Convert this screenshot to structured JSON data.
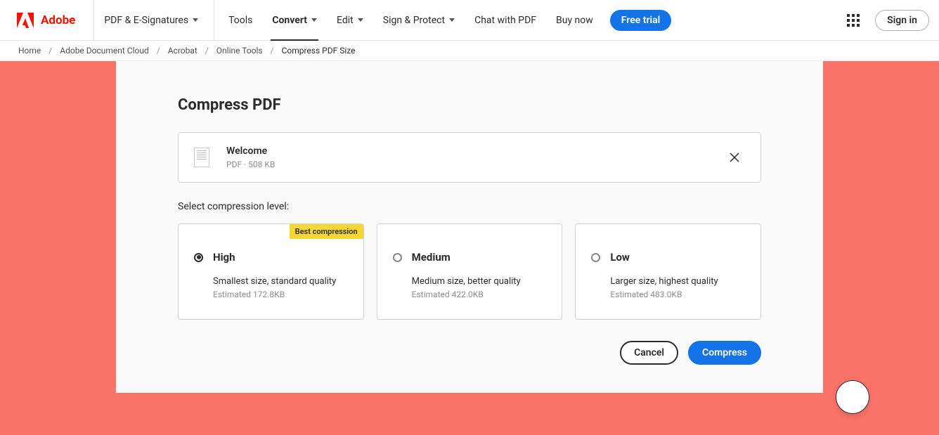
{
  "brand": "Adobe",
  "nav": {
    "pdf_sig": "PDF & E-Signatures",
    "tools": "Tools",
    "convert": "Convert",
    "edit": "Edit",
    "sign_protect": "Sign & Protect",
    "chat": "Chat with PDF",
    "buy_now": "Buy now",
    "free_trial": "Free trial",
    "sign_in": "Sign in"
  },
  "breadcrumb": {
    "home": "Home",
    "doc_cloud": "Adobe Document Cloud",
    "acrobat": "Acrobat",
    "online_tools": "Online Tools",
    "current": "Compress PDF Size"
  },
  "title": "Compress PDF",
  "file": {
    "name": "Welcome",
    "meta": "PDF · 508 KB"
  },
  "prompt": "Select compression level:",
  "levels": [
    {
      "name": "High",
      "desc": "Smallest size, standard quality",
      "est": "Estimated 172.8KB",
      "selected": true,
      "best": "Best compression"
    },
    {
      "name": "Medium",
      "desc": "Medium size, better quality",
      "est": "Estimated 422.0KB",
      "selected": false
    },
    {
      "name": "Low",
      "desc": "Larger size, highest quality",
      "est": "Estimated 483.0KB",
      "selected": false
    }
  ],
  "actions": {
    "cancel": "Cancel",
    "compress": "Compress"
  }
}
